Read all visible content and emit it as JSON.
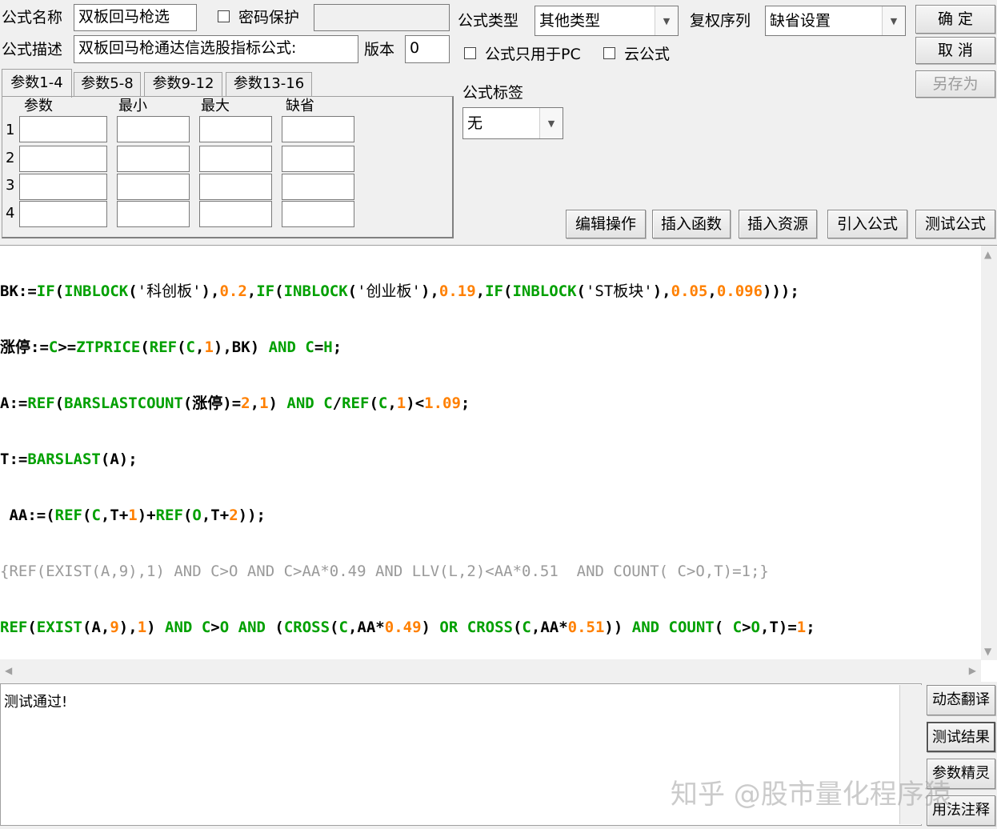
{
  "header": {
    "name_label": "公式名称",
    "name_value": "双板回马枪选",
    "password_label": "密码保护",
    "password_value": "",
    "desc_label": "公式描述",
    "desc_value": "双板回马枪通达信选股指标公式:",
    "version_label": "版本",
    "version_value": "0",
    "type_label": "公式类型",
    "type_value": "其他类型",
    "rights_label": "复权序列",
    "rights_value": "缺省设置",
    "pc_only_label": "公式只用于PC",
    "cloud_label": "云公式",
    "tag_label": "公式标签",
    "tag_value": "无"
  },
  "buttons": {
    "ok": "确  定",
    "cancel": "取  消",
    "save_as": "另存为",
    "edit_ops": "编辑操作",
    "insert_func": "插入函数",
    "insert_res": "插入资源",
    "import_formula": "引入公式",
    "test_formula": "测试公式"
  },
  "tabs": [
    "参数1-4",
    "参数5-8",
    "参数9-12",
    "参数13-16"
  ],
  "param_table": {
    "columns": [
      "参数",
      "最小",
      "最大",
      "缺省"
    ],
    "rows": [
      "1",
      "2",
      "3",
      "4"
    ]
  },
  "code_lines": [
    "BK:=IF(INBLOCK('科创板'),0.2,IF(INBLOCK('创业板'),0.19,IF(INBLOCK('ST板块'),0.05,0.096)));",
    "涨停:=C>=ZTPRICE(REF(C,1),BK) AND C=H;",
    "A:=REF(BARSLASTCOUNT(涨停)=2,1) AND C/REF(C,1)<1.09;",
    "T:=BARSLAST(A);",
    " AA:=(REF(C,T+1)+REF(O,T+2));",
    "{REF(EXIST(A,9),1) AND C>O AND C>AA*0.49 AND LLV(L,2)<AA*0.51  AND COUNT( C>O,T)=1;}",
    "REF(EXIST(A,9),1) AND C>O AND (CROSS(C,AA*0.49) OR CROSS(C,AA*0.51)) AND COUNT( C>O,T)=1;"
  ],
  "result": {
    "text": "测试通过!"
  },
  "side_buttons": [
    "动态翻译",
    "测试结果",
    "参数精灵",
    "用法注释"
  ],
  "watermark": "知乎 @股市量化程序猿",
  "colors": {
    "keyword": "#00a000",
    "number": "#ff8000",
    "text": "#000000",
    "comment": "#9a9a9a"
  }
}
